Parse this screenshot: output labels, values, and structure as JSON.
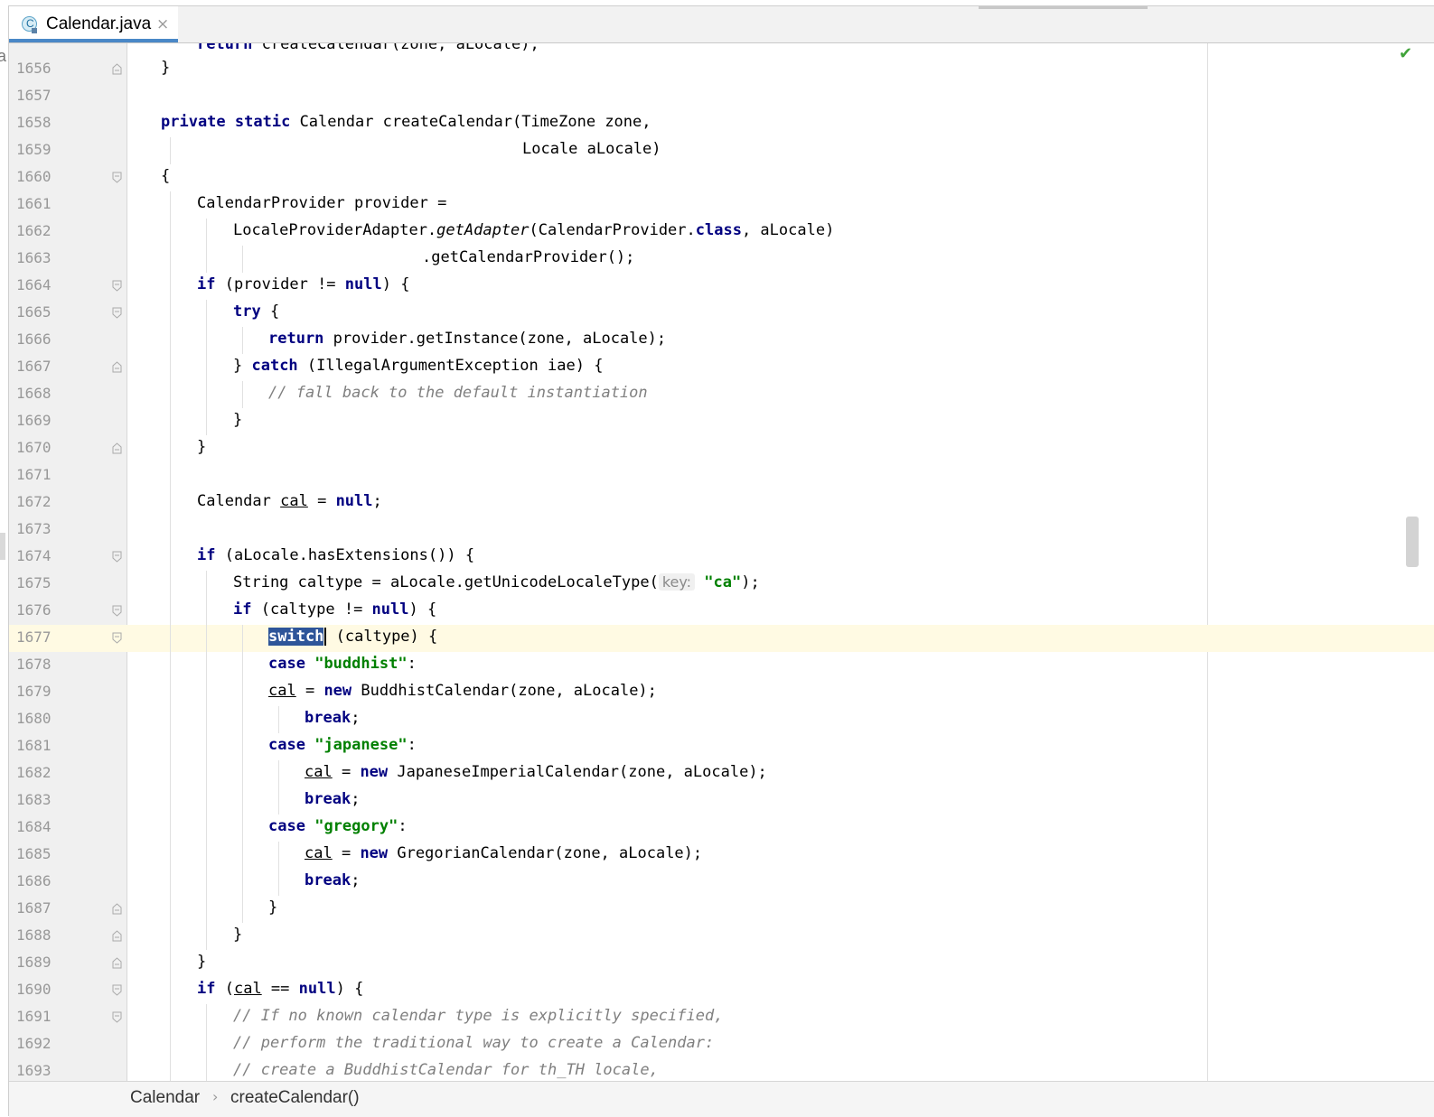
{
  "tab": {
    "label": "Calendar.java",
    "icon_letter": "C",
    "close": "×"
  },
  "breadcrumb": {
    "items": [
      "Calendar",
      "createCalendar()"
    ],
    "separator": "›"
  },
  "status": {
    "check": "✔"
  },
  "lines": {
    "partial": "return createCalendar(zone, aLocale);",
    "n1656": "1656",
    "n1657": "1657",
    "n1658": "1658",
    "n1659": "1659",
    "n1660": "1660",
    "n1661": "1661",
    "n1662": "1662",
    "n1663": "1663",
    "n1664": "1664",
    "n1665": "1665",
    "n1666": "1666",
    "n1667": "1667",
    "n1668": "1668",
    "n1669": "1669",
    "n1670": "1670",
    "n1671": "1671",
    "n1672": "1672",
    "n1673": "1673",
    "n1674": "1674",
    "n1675": "1675",
    "n1676": "1676",
    "n1677": "1677",
    "n1678": "1678",
    "n1679": "1679",
    "n1680": "1680",
    "n1681": "1681",
    "n1682": "1682",
    "n1683": "1683",
    "n1684": "1684",
    "n1685": "1685",
    "n1686": "1686",
    "n1687": "1687",
    "n1688": "1688",
    "n1689": "1689",
    "n1690": "1690",
    "n1691": "1691",
    "n1692": "1692",
    "n1693": "1693"
  },
  "tokens": {
    "brace_close": "}",
    "brace_open": "{",
    "private": "private",
    "static": "static",
    "sig1": " Calendar createCalendar(TimeZone zone,",
    "sig2": "Locale aLocale)",
    "provider_decl": "CalendarProvider provider =",
    "lpa": "LocaleProviderAdapter.",
    "getAdapter": "getAdapter",
    "lpa_args": "(CalendarProvider.",
    "class": "class",
    "lpa_end": ", aLocale)",
    "get_cal_provider": ".getCalendarProvider();",
    "if": "if",
    "if_provider": " (provider != ",
    "null": "null",
    "paren_brace": ") {",
    "semicolon": ";",
    "try": "try",
    "space_brace": " {",
    "return": "return",
    "return_provider": " provider.getInstance(zone, aLocale);",
    "close_brace_space": "} ",
    "catch": "catch",
    "catch_args": " (IllegalArgumentException iae) {",
    "comment_fallback": "// fall back to the default instantiation",
    "calendar_type": "Calendar ",
    "cal": "cal",
    "eq_null": " = ",
    "has_ext": " (aLocale.hasExtensions()) {",
    "string_caltype": "String caltype = aLocale.getUnicodeLocaleType(",
    "key_hint": "key:",
    "str_ca": "\"ca\"",
    "paren_semicolon": ");",
    "caltype_ne": " (caltype != ",
    "switch": "switch",
    "switch_args": " (caltype) {",
    "case": "case",
    "str_buddhist": "\"buddhist\"",
    "colon": ":",
    "assign_new": " = ",
    "new": "new",
    "buddhist_ctor": " BuddhistCalendar(zone, aLocale);",
    "break": "break",
    "str_japanese": "\"japanese\"",
    "japanese_ctor": " JapaneseImperialCalendar(zone, aLocale);",
    "str_gregory": "\"gregory\"",
    "gregorian_ctor": " GregorianCalendar(zone, aLocale);",
    "if_paren": " (",
    "eq_eq": " == ",
    "comment1": "// If no known calendar type is explicitly specified,",
    "comment2": "// perform the traditional way to create a Calendar:",
    "comment3": "// create a BuddhistCalendar for th_TH locale,"
  }
}
